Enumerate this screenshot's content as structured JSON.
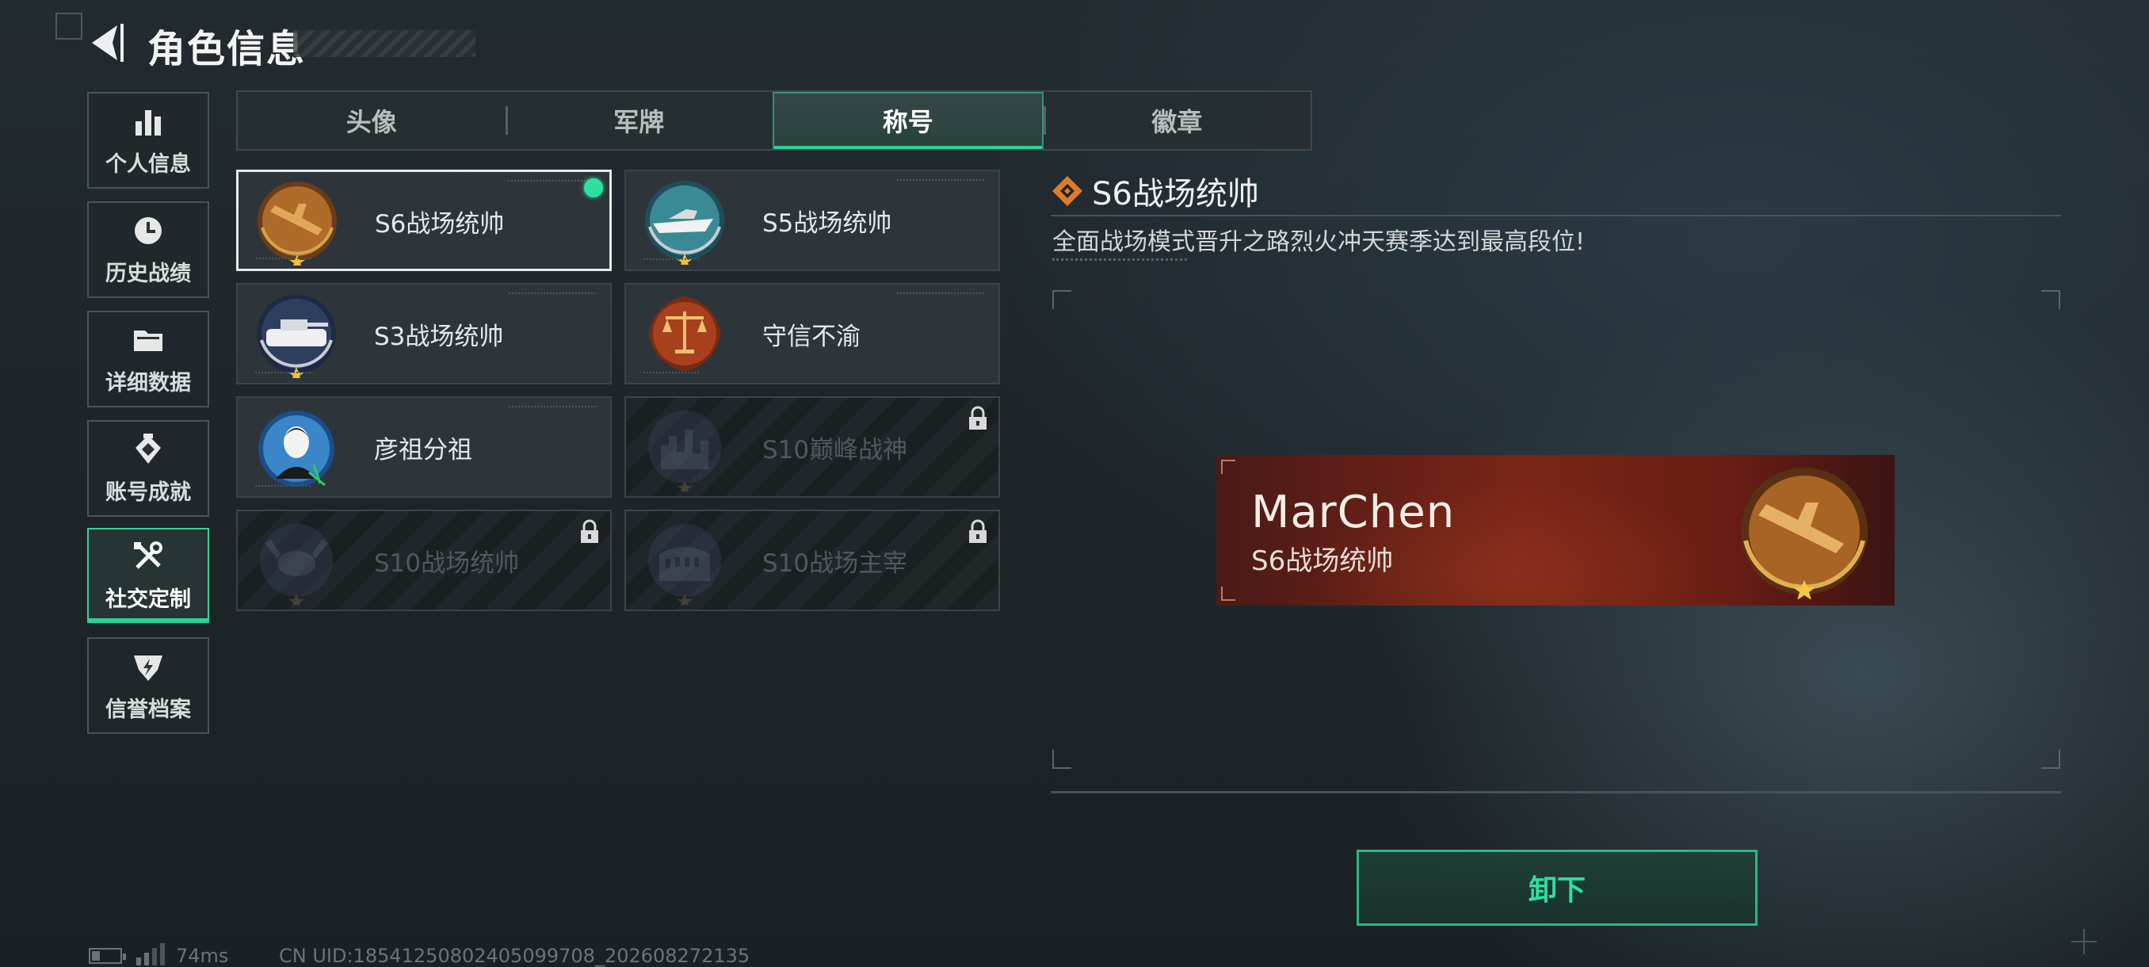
{
  "header": {
    "title": "角色信息"
  },
  "sidebar": {
    "items": [
      {
        "label": "个人信息",
        "icon": "bar-chart-icon"
      },
      {
        "label": "历史战绩",
        "icon": "clock-icon"
      },
      {
        "label": "详细数据",
        "icon": "folder-icon"
      },
      {
        "label": "账号成就",
        "icon": "achievement-icon"
      },
      {
        "label": "社交定制",
        "icon": "tools-icon",
        "active": true
      },
      {
        "label": "信誉档案",
        "icon": "shield-icon"
      }
    ]
  },
  "tabs": [
    {
      "label": "头像"
    },
    {
      "label": "军牌"
    },
    {
      "label": "称号",
      "active": true
    },
    {
      "label": "徽章"
    }
  ],
  "titles": [
    {
      "name": "S6战场统帅",
      "emblem": "jet-emblem",
      "selected": true,
      "equipped": true,
      "locked": false
    },
    {
      "name": "S5战场统帅",
      "emblem": "boat-emblem",
      "selected": false,
      "locked": false
    },
    {
      "name": "S3战场统帅",
      "emblem": "tank-emblem",
      "selected": false,
      "locked": false
    },
    {
      "name": "守信不渝",
      "emblem": "scales-emblem",
      "selected": false,
      "locked": false
    },
    {
      "name": "彦祖分祖",
      "emblem": "portrait-emblem",
      "selected": false,
      "locked": false
    },
    {
      "name": "S10巅峰战神",
      "emblem": "city-emblem",
      "selected": false,
      "locked": true
    },
    {
      "name": "S10战场统帅",
      "emblem": "crab-emblem",
      "selected": false,
      "locked": true
    },
    {
      "name": "S10战场主宰",
      "emblem": "colosseum-emblem",
      "selected": false,
      "locked": true
    }
  ],
  "detail": {
    "title": "S6战场统帅",
    "description": "全面战场模式晋升之路烈火冲天赛季达到最高段位!",
    "banner": {
      "player_name": "MarChen",
      "title": "S6战场统帅"
    },
    "unequip_label": "卸下"
  },
  "footer": {
    "ping": "74ms",
    "uid": "CN UID:18541250802405099708_202608272135"
  },
  "colors": {
    "accent": "#2ad49b",
    "banner_red": "#7a2418",
    "gold": "#d4a44a"
  }
}
